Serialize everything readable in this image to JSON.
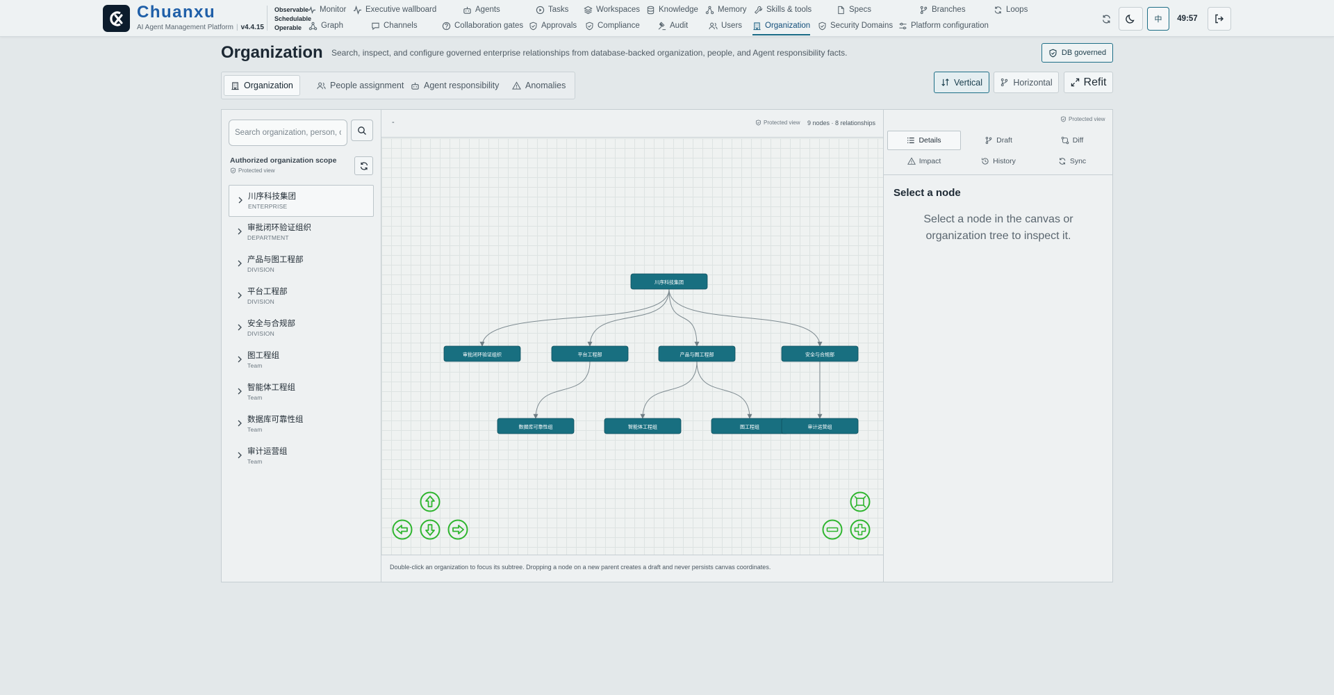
{
  "brand": {
    "name": "Chuanxu",
    "subtitle": "AI Agent Management Platform",
    "version": "v4.4.15",
    "taglines": [
      "Observable",
      "Schedulable",
      "Operable"
    ]
  },
  "nav": {
    "row1": [
      {
        "label": "Monitor",
        "icon": "monitor-icon"
      },
      {
        "label": "Executive wallboard",
        "icon": "pulse-icon"
      },
      {
        "label": "Agents",
        "icon": "bot-icon"
      },
      {
        "label": "Tasks",
        "icon": "play-circle-icon"
      },
      {
        "label": "Workspaces",
        "icon": "layers-icon"
      },
      {
        "label": "Knowledge",
        "icon": "database-icon"
      },
      {
        "label": "Memory",
        "icon": "network-icon"
      },
      {
        "label": "Skills & tools",
        "icon": "wrench-icon"
      },
      {
        "label": "Specs",
        "icon": "file-icon"
      },
      {
        "label": "Branches",
        "icon": "branch-icon"
      },
      {
        "label": "Loops",
        "icon": "refresh-icon"
      }
    ],
    "row2": [
      {
        "label": "Graph",
        "icon": "graph-icon"
      },
      {
        "label": "Channels",
        "icon": "chat-icon"
      },
      {
        "label": "Collaboration gates",
        "icon": "help-circle-icon"
      },
      {
        "label": "Approvals",
        "icon": "shield-check-icon"
      },
      {
        "label": "Compliance",
        "icon": "shield-check-icon"
      },
      {
        "label": "Audit",
        "icon": "gavel-icon"
      },
      {
        "label": "Users",
        "icon": "users-icon"
      },
      {
        "label": "Organization",
        "icon": "building-icon"
      },
      {
        "label": "Security Domains",
        "icon": "shield-check-icon"
      },
      {
        "label": "Platform configuration",
        "icon": "sliders-icon"
      }
    ],
    "active": "Organization"
  },
  "header_actions": {
    "language": "中",
    "timer": "49:57"
  },
  "page": {
    "title": "Organization",
    "description": "Search, inspect, and configure governed enterprise relationships from database-backed organization, people, and Agent responsibility facts.",
    "badge": "DB governed"
  },
  "tabs": [
    {
      "label": "Organization",
      "icon": "building-icon",
      "active": true
    },
    {
      "label": "People assignment",
      "icon": "users-icon",
      "active": false
    },
    {
      "label": "Agent responsibility",
      "icon": "bot-icon",
      "active": false
    },
    {
      "label": "Anomalies",
      "icon": "warning-icon",
      "active": false
    }
  ],
  "view_controls": {
    "vertical": "Vertical",
    "horizontal": "Horizontal",
    "refit": "Refit"
  },
  "left_panel": {
    "search_placeholder": "Search organization, person, or",
    "scope_title": "Authorized organization scope",
    "scope_note": "Protected view",
    "tree": [
      {
        "name": "川序科技集团",
        "type": "ENTERPRISE"
      },
      {
        "name": "审批闭环验证组织",
        "type": "DEPARTMENT"
      },
      {
        "name": "产品与图工程部",
        "type": "DIVISION"
      },
      {
        "name": "平台工程部",
        "type": "DIVISION"
      },
      {
        "name": "安全与合规部",
        "type": "DIVISION"
      },
      {
        "name": "图工程组",
        "type": "Team"
      },
      {
        "name": "智能体工程组",
        "type": "Team"
      },
      {
        "name": "数据库可靠性组",
        "type": "Team"
      },
      {
        "name": "审计运营组",
        "type": "Team"
      }
    ]
  },
  "canvas": {
    "header_text": "-",
    "protected_note": "Protected view",
    "count": "9 nodes · 8 relationships",
    "footer": "Double-click an organization to focus its subtree. Dropping a node on a new parent creates a draft and never persists canvas coordinates.",
    "nodes": {
      "root": "川序科技集团",
      "d1": "审批闭环验证组织",
      "d2": "平台工程部",
      "d3": "产品与图工程部",
      "d4": "安全与合规部",
      "t1": "数据库可靠性组",
      "t2": "智能体工程组",
      "t3": "图工程组",
      "t4": "审计运营组"
    },
    "edges": [
      [
        "root",
        "d1"
      ],
      [
        "root",
        "d2"
      ],
      [
        "root",
        "d3"
      ],
      [
        "root",
        "d4"
      ],
      [
        "d2",
        "t1"
      ],
      [
        "d3",
        "t2"
      ],
      [
        "d3",
        "t3"
      ],
      [
        "d4",
        "t4"
      ]
    ],
    "node_color": "#186f80",
    "control_color": "#2fb52f"
  },
  "right_panel": {
    "protected_note": "Protected view",
    "tabs": [
      {
        "label": "Details",
        "icon": "list-icon",
        "active": true
      },
      {
        "label": "Draft",
        "icon": "branch-icon",
        "active": false
      },
      {
        "label": "Diff",
        "icon": "diff-icon",
        "active": false
      },
      {
        "label": "Impact",
        "icon": "warning-icon",
        "active": false
      },
      {
        "label": "History",
        "icon": "history-icon",
        "active": false
      },
      {
        "label": "Sync",
        "icon": "refresh-icon",
        "active": false
      }
    ],
    "title": "Select a node",
    "message": "Select a node in the canvas or organization tree to inspect it."
  }
}
